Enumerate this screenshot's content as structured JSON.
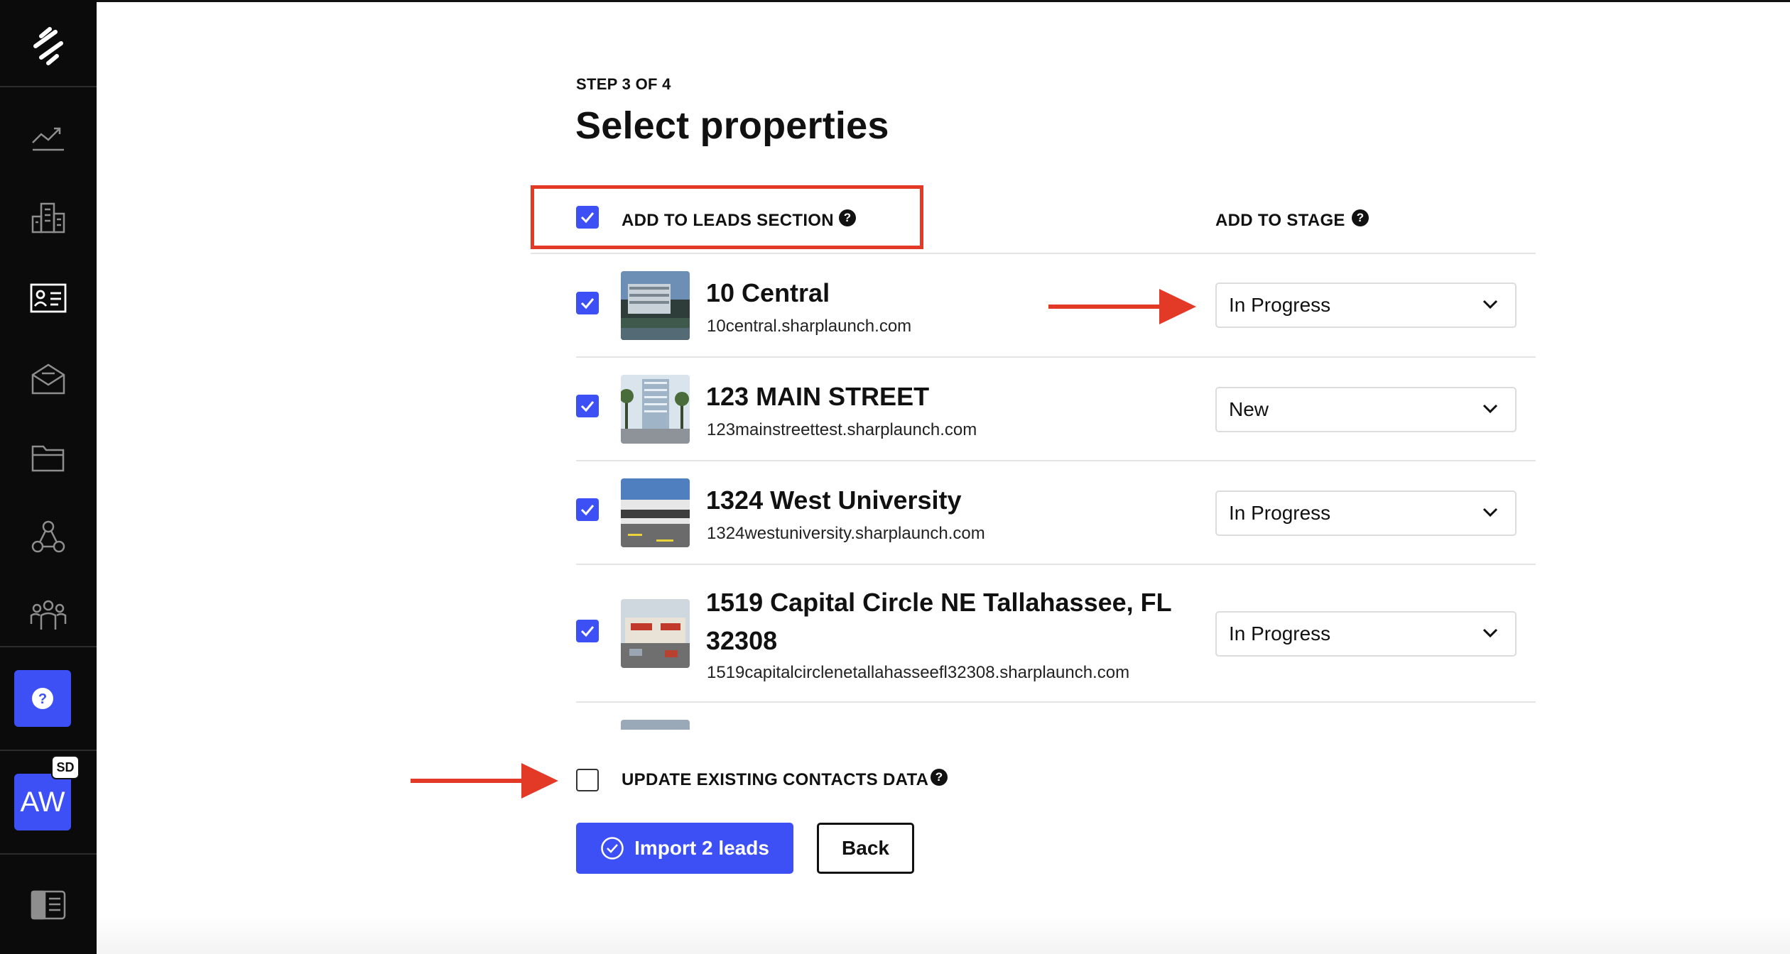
{
  "sidebar": {
    "logo_icon": "sharplaunch-logo-icon",
    "items": [
      {
        "icon": "analytics-chart-icon"
      },
      {
        "icon": "buildings-icon"
      },
      {
        "icon": "contact-card-icon"
      },
      {
        "icon": "mail-envelope-icon"
      },
      {
        "icon": "folder-icon"
      },
      {
        "icon": "network-nodes-icon"
      },
      {
        "icon": "team-people-icon"
      }
    ],
    "help_icon": "question-icon",
    "avatar_initials": "AW",
    "avatar_badge": "SD",
    "bottom_icon": "panel-layout-icon"
  },
  "wizard": {
    "step_label": "STEP 3 OF 4",
    "title": "Select properties",
    "add_to_leads_label": "ADD TO LEADS SECTION",
    "add_to_leads_checked": true,
    "add_to_stage_label": "ADD TO STAGE",
    "properties": [
      {
        "name": "10 Central",
        "url": "10central.sharplaunch.com",
        "checked": true,
        "stage": "In Progress"
      },
      {
        "name": "123 MAIN STREET",
        "url": "123mainstreettest.sharplaunch.com",
        "checked": true,
        "stage": "New"
      },
      {
        "name": "1324 West University",
        "url": "1324westuniversity.sharplaunch.com",
        "checked": true,
        "stage": "In Progress"
      },
      {
        "name_line1": "1519 Capital Circle NE Tallahassee, FL",
        "name_line2": "32308",
        "url": "1519capitalcirclenetallahasseefl32308.sharplaunch.com",
        "checked": true,
        "stage": "In Progress"
      }
    ],
    "update_contacts_label": "UPDATE EXISTING CONTACTS DATA",
    "update_contacts_checked": false,
    "import_button": "Import 2 leads",
    "back_button": "Back"
  },
  "colors": {
    "accent": "#3d50f5",
    "annotation": "#e23a27",
    "sidebar_bg": "#0b0b0b"
  }
}
